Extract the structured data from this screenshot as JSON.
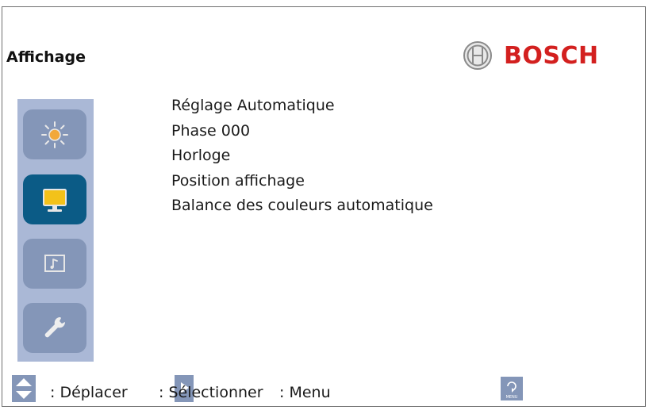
{
  "header": {
    "title": "Affichage",
    "brand": "BOSCH"
  },
  "sidebar": {
    "items": [
      {
        "icon": "brightness-icon",
        "active": false
      },
      {
        "icon": "monitor-icon",
        "active": true
      },
      {
        "icon": "audio-icon",
        "active": false
      },
      {
        "icon": "wrench-icon",
        "active": false
      }
    ]
  },
  "menu": {
    "items": [
      "Réglage Automatique",
      "Phase 000",
      "Horloge",
      "Position affichage",
      "Balance des couleurs automatique"
    ]
  },
  "footer": {
    "move_label": ": Déplacer",
    "select_label": ": Sélectionner",
    "menu_label": ": Menu",
    "menu_icon_caption": "MENU"
  },
  "colors": {
    "brand": "#d3201f",
    "sidebar_bg": "#aab8d6",
    "button_bg": "#8496b8",
    "button_active": "#0b5b86",
    "monitor_screen": "#f3c21a"
  }
}
